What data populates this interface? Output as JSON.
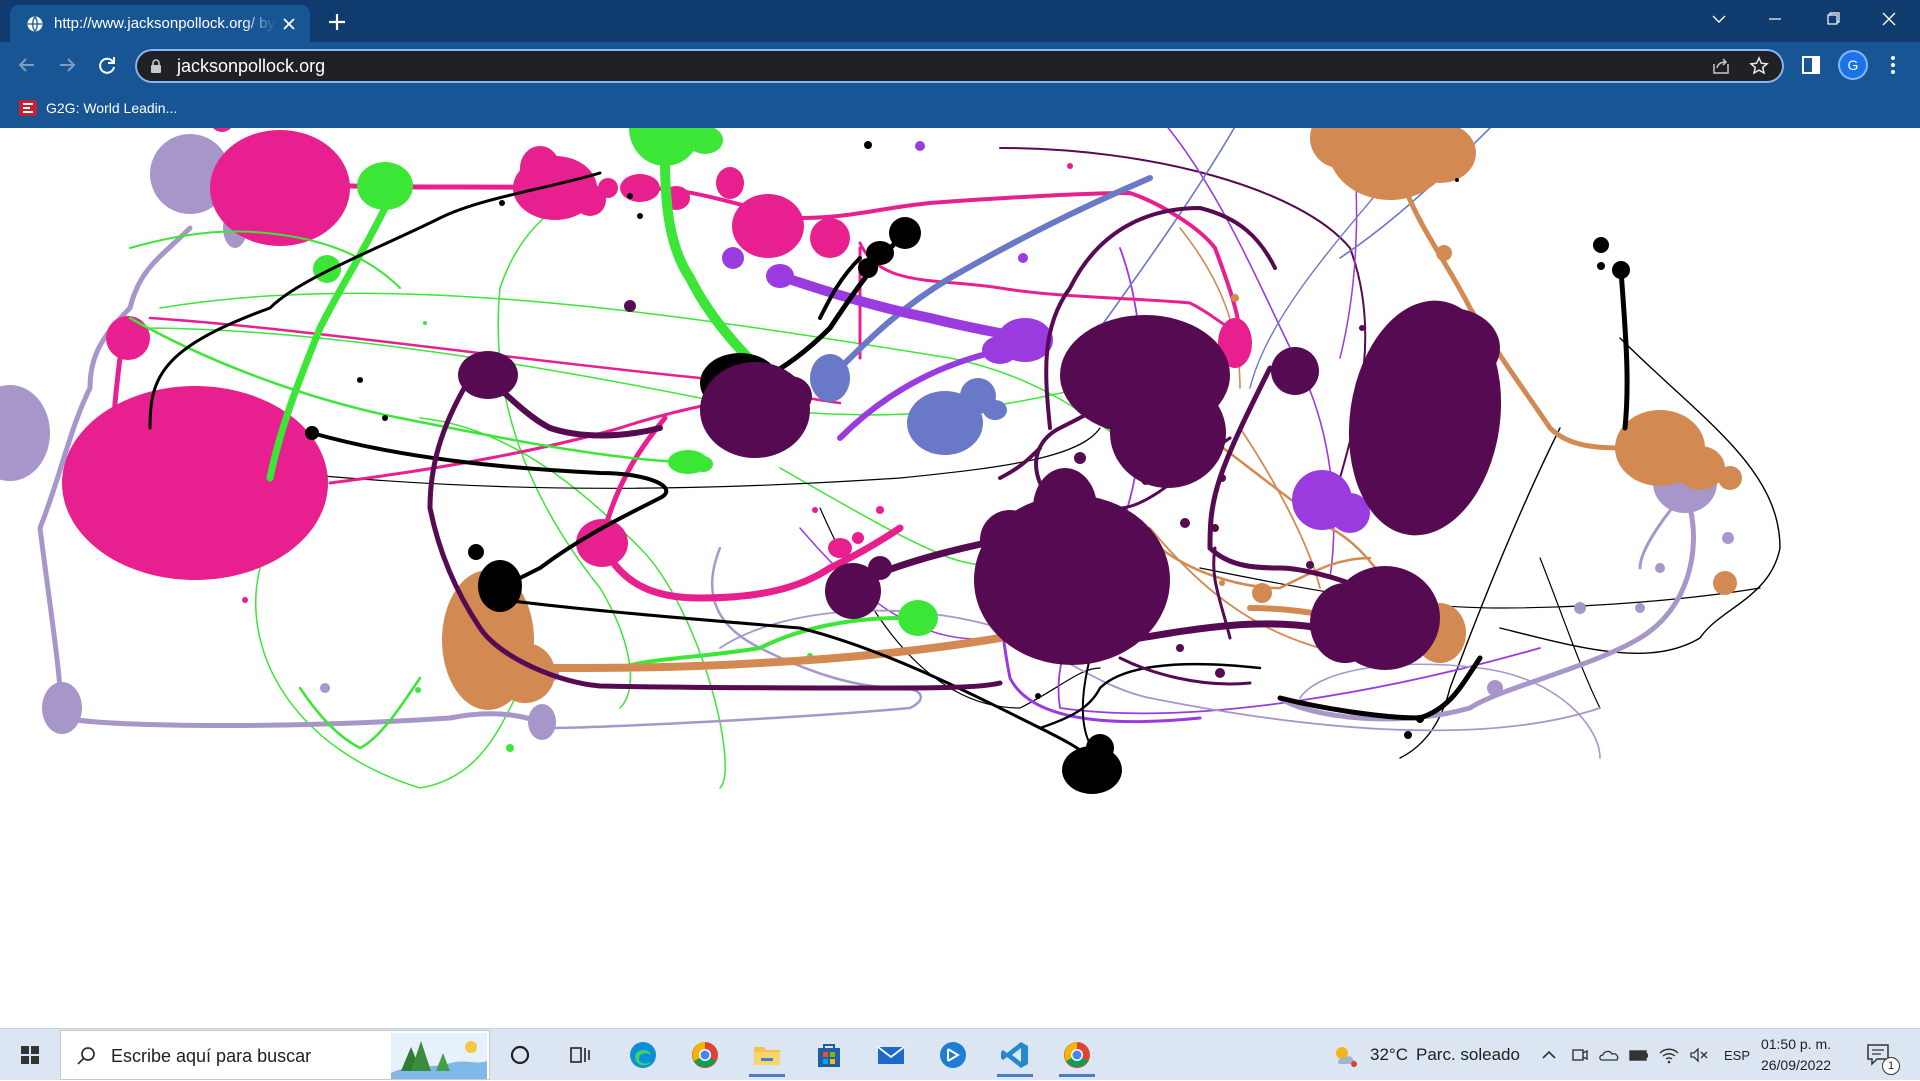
{
  "browser": {
    "tab_title": "http://www.jacksonpollock.org/ by Miltos Manetas",
    "url": "jacksonpollock.org",
    "profile_initial": "G"
  },
  "bookmarks": [
    {
      "label": "G2G: World Leadin..."
    }
  ],
  "page": {
    "colors": [
      "#e8208f",
      "#3ce637",
      "#560a52",
      "#000000",
      "#d38a52",
      "#a796c9",
      "#9a3be0",
      "#6a78c8"
    ]
  },
  "taskbar": {
    "search_placeholder": "Escribe aquí para buscar",
    "apps": [
      "cortana-icon",
      "task-view-icon",
      "edge-icon",
      "chrome-icon",
      "file-explorer-icon",
      "store-icon",
      "mail-icon",
      "app-icon",
      "vscode-icon",
      "chrome-icon"
    ],
    "weather": {
      "temp": "32°C",
      "condition": "Parc. soleado"
    },
    "language": "ESP",
    "time": "01:50 p. m.",
    "date": "26/09/2022",
    "notification_count": "1"
  }
}
